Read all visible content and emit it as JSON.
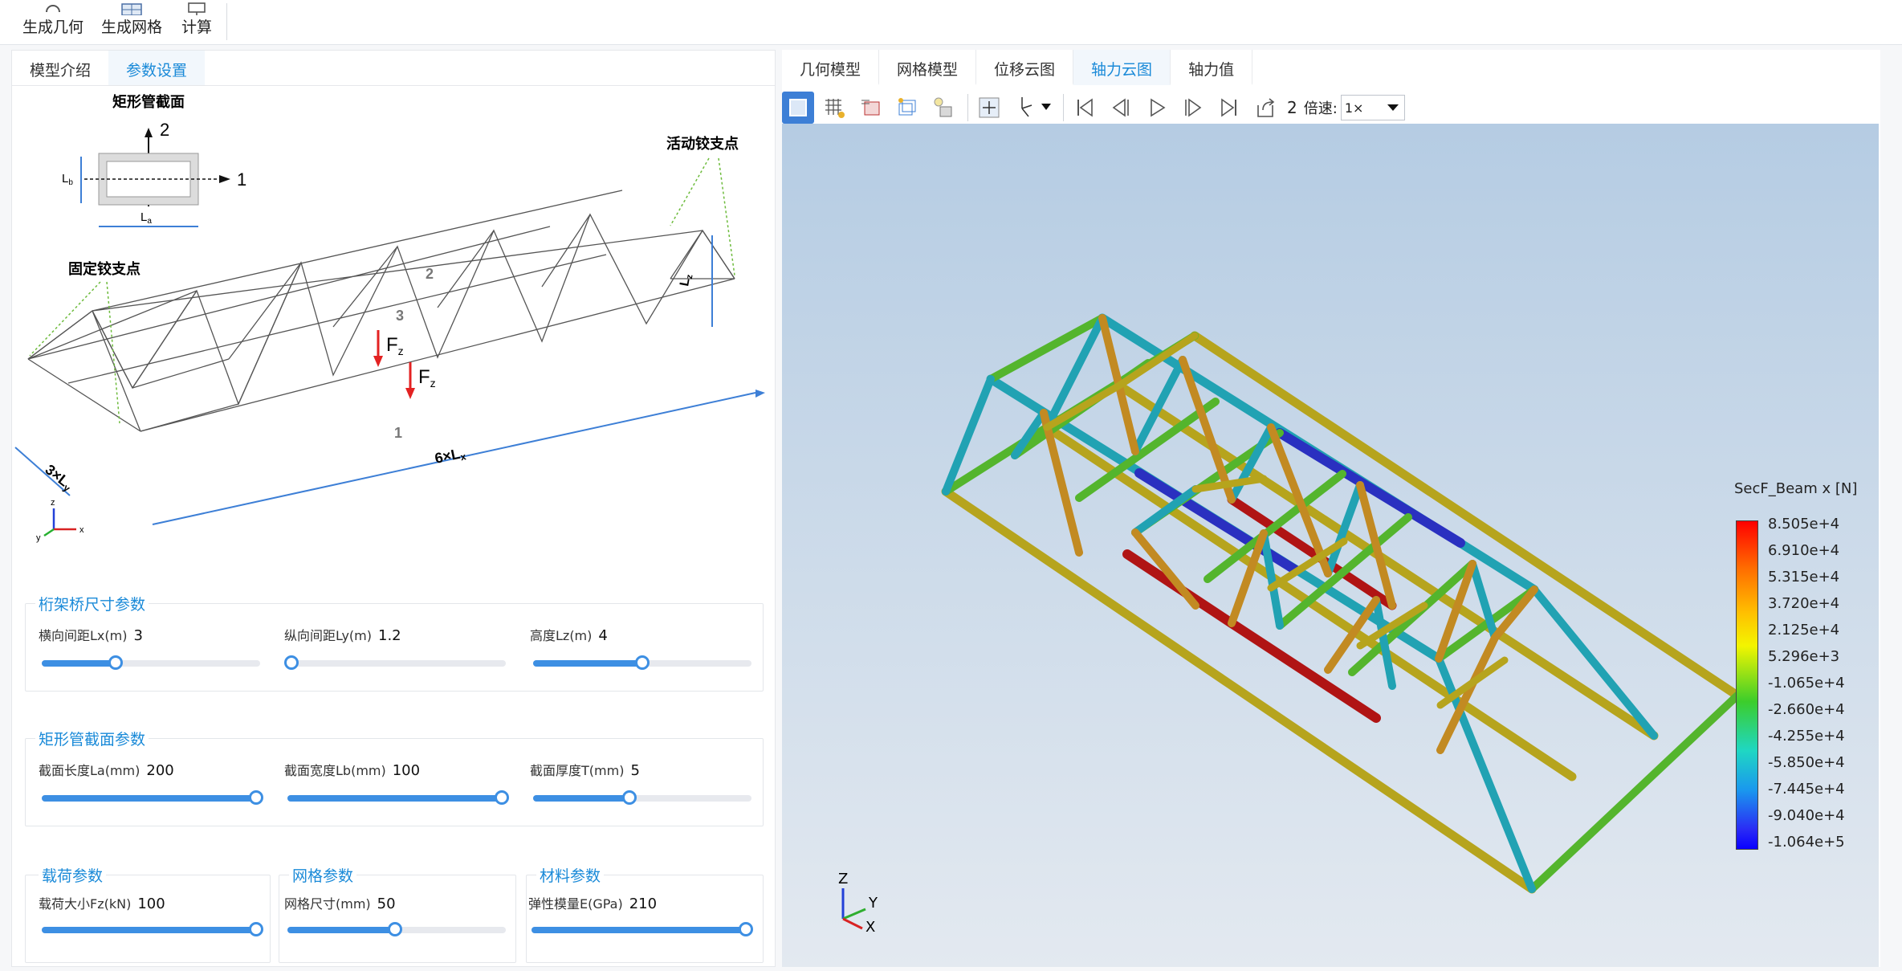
{
  "ribbon": {
    "gen_geometry": "生成几何",
    "gen_mesh": "生成网格",
    "compute": "计算"
  },
  "left_tabs": [
    "模型介绍",
    "参数设置"
  ],
  "schematic": {
    "section_title": "矩形管截面",
    "axis_2": "2",
    "axis_1": "1",
    "lb": "L",
    "lb_sub": "b",
    "la": "L",
    "la_sub": "a",
    "movable_support": "活动铰支点",
    "fixed_support": "固定铰支点",
    "lz": "L",
    "lz_sub": "z",
    "fz1": "F",
    "fz2": "F",
    "fz_sub": "z",
    "n1": "1",
    "n2": "2",
    "n3": "3",
    "dim_long": "6×L",
    "dim_long_sub": "x",
    "dim_short": "3×L",
    "dim_short_sub": "y",
    "axis_z": "z",
    "axis_y": "y",
    "axis_x": "x"
  },
  "groups": {
    "truss": {
      "title": "桁架桥尺寸参数",
      "params": [
        {
          "label": "横向间距Lx(m)",
          "value": "3",
          "pct": 33
        },
        {
          "label": "纵向间距Ly(m)",
          "value": "1.2",
          "pct": 0
        },
        {
          "label": "高度Lz(m)",
          "value": "4",
          "pct": 50
        }
      ]
    },
    "section": {
      "title": "矩形管截面参数",
      "params": [
        {
          "label": "截面长度La(mm)",
          "value": "200",
          "pct": 100
        },
        {
          "label": "截面宽度Lb(mm)",
          "value": "100",
          "pct": 100
        },
        {
          "label": "截面厚度T(mm)",
          "value": "5",
          "pct": 44
        }
      ]
    },
    "load": {
      "title": "载荷参数",
      "label": "载荷大小Fz(kN)",
      "value": "100",
      "pct": 100
    },
    "mesh": {
      "title": "网格参数",
      "label": "网格尺寸(mm)",
      "value": "50",
      "pct": 49
    },
    "material": {
      "title": "材料参数",
      "label": "弹性模量E(GPa)",
      "value": "210",
      "pct": 100
    }
  },
  "right_tabs": [
    "几何模型",
    "网格模型",
    "位移云图",
    "轴力云图",
    "轴力值"
  ],
  "right_active_tab": "轴力云图",
  "toolbar": {
    "frame": "2",
    "speed_label": "倍速:",
    "speed_value": "1×"
  },
  "legend": {
    "title": "SecF_Beam x [N]",
    "labels": [
      "8.505e+4",
      "6.910e+4",
      "5.315e+4",
      "3.720e+4",
      "2.125e+4",
      "5.296e+3",
      "-1.065e+4",
      "-2.660e+4",
      "-4.255e+4",
      "-5.850e+4",
      "-7.445e+4",
      "-9.040e+4",
      "-1.064e+5"
    ]
  },
  "triad": {
    "z": "Z",
    "y": "Y",
    "x": "X"
  },
  "colors": {
    "accent": "#1a8ad8",
    "slider": "#3d8fe3"
  }
}
